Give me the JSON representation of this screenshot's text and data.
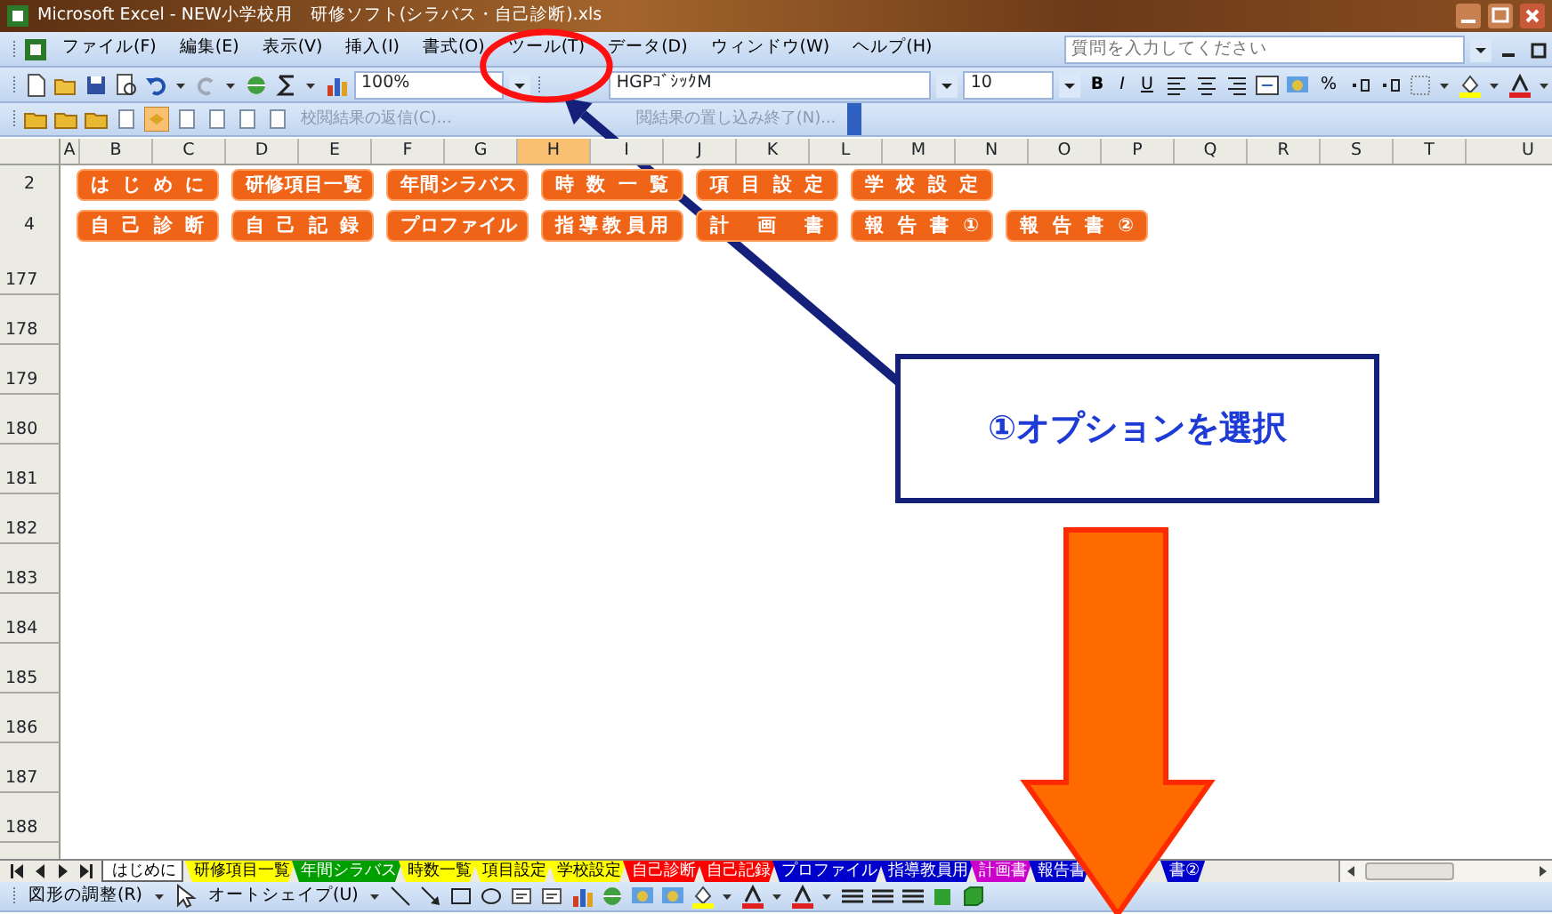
{
  "window": {
    "title": "Microsoft Excel - NEW小学校用　研修ソフト(シラバス・自己診断).xls"
  },
  "menu": [
    "ファイル(F)",
    "編集(E)",
    "表示(V)",
    "挿入(I)",
    "書式(O)",
    "ツール(T)",
    "データ(D)",
    "ウィンドウ(W)",
    "ヘルプ(H)"
  ],
  "help_search": {
    "placeholder": "質問を入力してください"
  },
  "toolbar": {
    "zoom": "100%",
    "font": "HGPｺﾞｼｯｸM",
    "font_size": "10",
    "format_buttons": [
      "B",
      "I",
      "U"
    ],
    "percent": "%"
  },
  "review_toolbar": [
    {
      "label": "校閲結果の返信(C)...",
      "disabled": true
    },
    {
      "label": "閲結果の置し込み終了(N)...",
      "disabled": true
    }
  ],
  "columns": [
    {
      "label": "A",
      "selected": false
    },
    {
      "label": "B",
      "selected": false
    },
    {
      "label": "C",
      "selected": false
    },
    {
      "label": "D",
      "selected": false
    },
    {
      "label": "E",
      "selected": false
    },
    {
      "label": "F",
      "selected": false
    },
    {
      "label": "G",
      "selected": false
    },
    {
      "label": "H",
      "selected": true
    },
    {
      "label": "I",
      "selected": false
    },
    {
      "label": "J",
      "selected": false
    },
    {
      "label": "K",
      "selected": false
    },
    {
      "label": "L",
      "selected": false
    },
    {
      "label": "M",
      "selected": false
    },
    {
      "label": "N",
      "selected": false
    },
    {
      "label": "O",
      "selected": false
    },
    {
      "label": "P",
      "selected": false
    },
    {
      "label": "Q",
      "selected": false
    },
    {
      "label": "R",
      "selected": false
    },
    {
      "label": "S",
      "selected": false
    },
    {
      "label": "T",
      "selected": false
    },
    {
      "label": "U",
      "selected": false
    }
  ],
  "top_rows": [
    "2",
    "4"
  ],
  "macro_buttons": [
    [
      "はじめに",
      "研修項目一覧",
      "年間シラバス",
      "時数一覧",
      "項目設定",
      "学校設定"
    ],
    [
      "自己診断",
      "自己記録",
      "プロファイル",
      "指導教員用",
      "計画書",
      "報告書①",
      "報告書②"
    ]
  ],
  "rows": [
    "177",
    "178",
    "179",
    "180",
    "181",
    "182",
    "183",
    "184",
    "185",
    "186",
    "187",
    "188"
  ],
  "sheet_tabs": [
    {
      "label": "はじめに",
      "color": "#ffffff",
      "selected": true
    },
    {
      "label": "研修項目一覧",
      "color": "#ffff00",
      "selected": false
    },
    {
      "label": "年間シラバス",
      "color": "#00a000",
      "selected": false
    },
    {
      "label": "時数一覧",
      "color": "#ffff00",
      "selected": false
    },
    {
      "label": "項目設定",
      "color": "#ffff00",
      "selected": false
    },
    {
      "label": "学校設定",
      "color": "#ffff00",
      "selected": false
    },
    {
      "label": "自己診断",
      "color": "#ff0000",
      "selected": false
    },
    {
      "label": "自己記録",
      "color": "#ff0000",
      "selected": false
    },
    {
      "label": "プロファイル",
      "color": "#0000cc",
      "selected": false
    },
    {
      "label": "指導教員用",
      "color": "#0000cc",
      "selected": false
    },
    {
      "label": "計画書",
      "color": "#cc00cc",
      "selected": false
    },
    {
      "label": "報告書",
      "color": "#0000cc",
      "selected": false
    },
    {
      "label": "書②",
      "color": "#0000cc",
      "selected": false
    }
  ],
  "drawing_toolbar": {
    "draw_menu": "図形の調整(R)",
    "autoshapes_menu": "オートシェイプ(U)"
  },
  "callout": {
    "text": "①オプションを選択"
  }
}
